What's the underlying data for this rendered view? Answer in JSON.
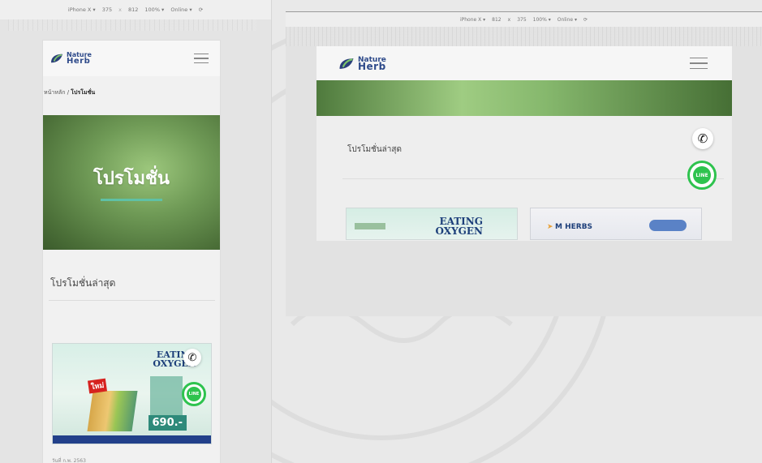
{
  "devtools": {
    "device": "iPhone X ▾",
    "width": "375",
    "times": "x",
    "height": "812",
    "zoom": "100% ▾",
    "network": "Online ▾",
    "rotate": "⟳"
  },
  "devtools_right": {
    "device": "iPhone X ▾",
    "width": "812",
    "times": "x",
    "height": "375",
    "zoom": "100% ▾",
    "network": "Online ▾",
    "rotate": "⟳"
  },
  "logo": {
    "line1": "Nature",
    "line2": "Herb"
  },
  "breadcrumb": {
    "home": "หน้าหลัก",
    "sep": " / ",
    "current": "โปรโมชั่น"
  },
  "hero": {
    "title": "โปรโมชั่น"
  },
  "section": {
    "title": "โปรโมชั่นล่าสุด"
  },
  "cards": [
    {
      "title_line1": "EATING",
      "title_line2": "OXYGEN",
      "badge": "ใหม่",
      "price": "690.-"
    },
    {
      "brand": "M HERBS"
    }
  ],
  "post_meta": "วันที่ ก.พ. 2563",
  "fab": {
    "line": "LINE"
  },
  "colors": {
    "brand_blue": "#2e4a8a",
    "hero_green": "#6f9a56",
    "accent_teal": "#5fc1a6",
    "line_green": "#2ec34e"
  }
}
